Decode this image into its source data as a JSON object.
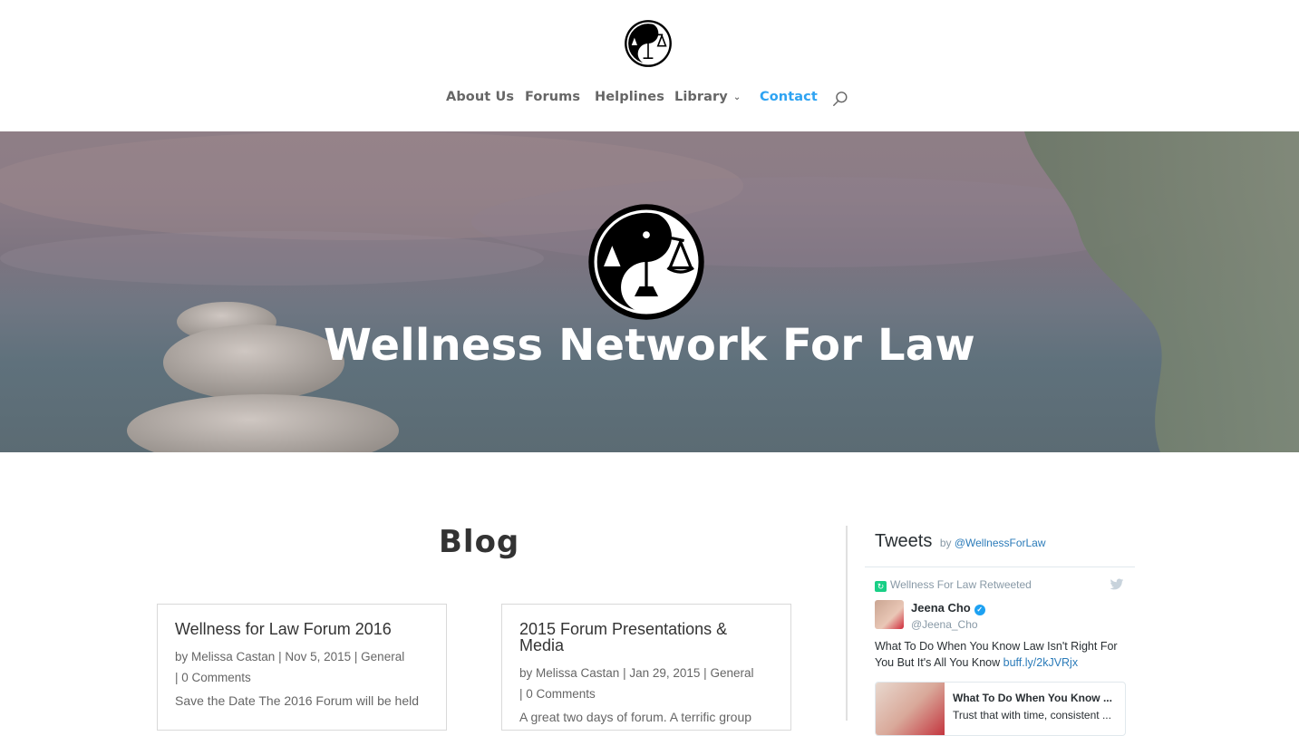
{
  "nav": {
    "items": [
      {
        "label": "About Us",
        "active": false
      },
      {
        "label": "Forums",
        "active": false
      },
      {
        "label": "Helplines",
        "active": false
      },
      {
        "label": "Library",
        "active": false,
        "has_dropdown": true
      },
      {
        "label": "Contact",
        "active": true
      }
    ],
    "search_icon": "search-icon"
  },
  "hero": {
    "title": "Wellness Network For Law"
  },
  "blog": {
    "heading": "Blog",
    "posts": [
      {
        "title": "Wellness for Law Forum 2016",
        "by": "by",
        "author": "Melissa Castan",
        "date": "Nov 5, 2015",
        "category": "General",
        "comments": "0 Comments",
        "excerpt": "Save the Date The 2016 Forum will be held"
      },
      {
        "title": "2015 Forum Presentations & Media",
        "by": "by",
        "author": "Melissa Castan",
        "date": "Jan 29, 2015",
        "category": "General",
        "comments": "0 Comments",
        "excerpt": "A great two days of forum. A terrific group"
      }
    ]
  },
  "tweets": {
    "heading": "Tweets",
    "by": "by",
    "account": "@WellnessForLaw",
    "retweeted": "Wellness For Law Retweeted",
    "tweet": {
      "name": "Jeena Cho",
      "handle": "@Jeena_Cho",
      "text": "What To Do When You Know Law Isn't Right For You But It's All You Know",
      "link": "buff.ly/2kJVRjx",
      "card_title": "What To Do When You Know ...",
      "card_desc": "Trust that with time, consistent ..."
    }
  },
  "colors": {
    "accent": "#2ea3f2",
    "nav_text": "#666666",
    "twitter_blue": "#1da1f2",
    "retweet_green": "#19cf86"
  }
}
